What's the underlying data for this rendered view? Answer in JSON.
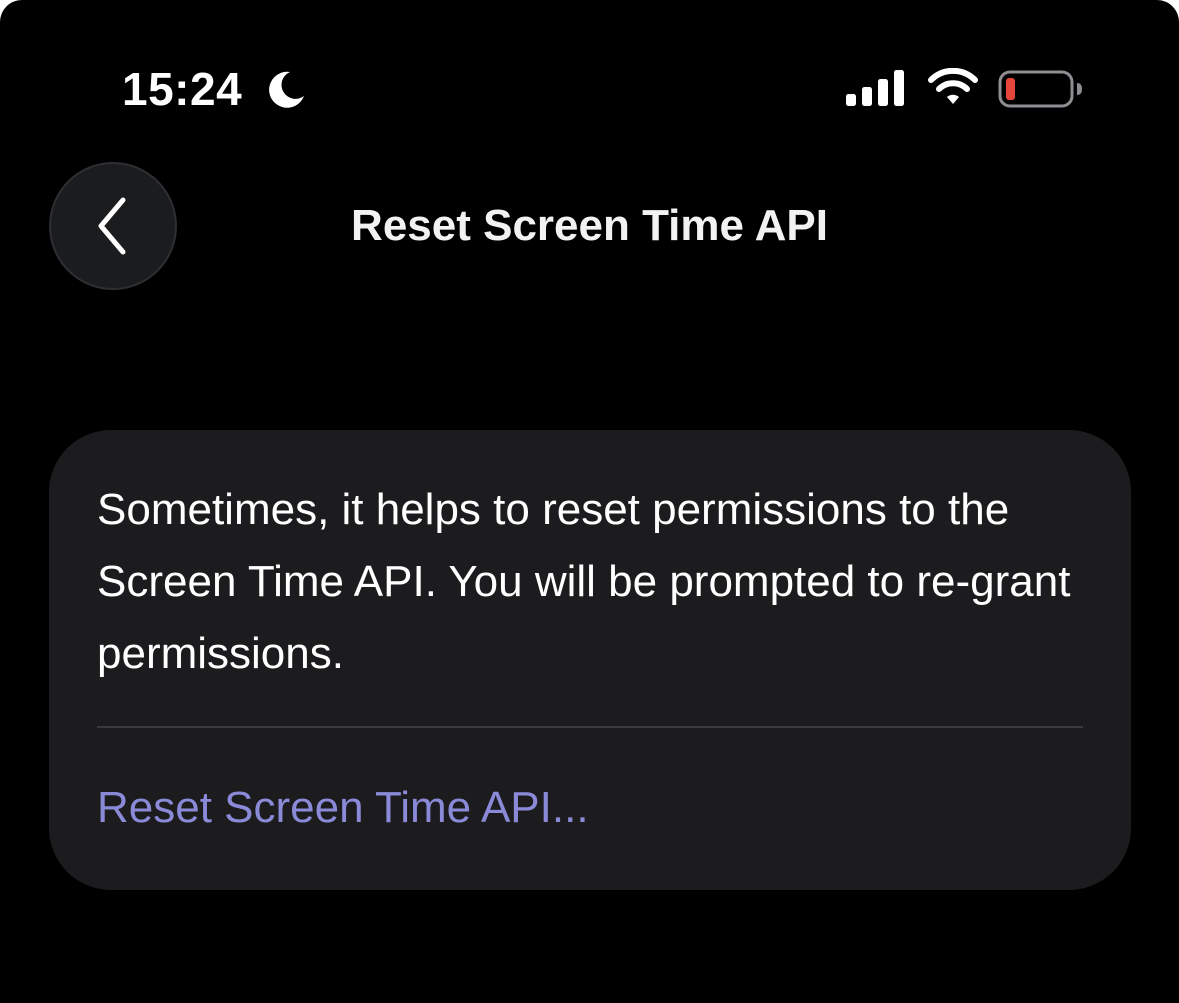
{
  "status_bar": {
    "time": "15:24",
    "icons": [
      "moon-icon",
      "cellular-signal-icon",
      "wifi-icon",
      "battery-low-icon"
    ],
    "battery_color": "#e5453b"
  },
  "nav": {
    "back_icon": "chevron-left-icon",
    "title": "Reset Screen Time API"
  },
  "card": {
    "description": "Sometimes, it helps to reset permissions to the Screen Time API. You will be prompted to re-grant permissions.",
    "action_label": "Reset Screen Time API..."
  },
  "colors": {
    "background": "#000000",
    "card": "#1c1c1e",
    "accent": "#8a8ad8"
  }
}
